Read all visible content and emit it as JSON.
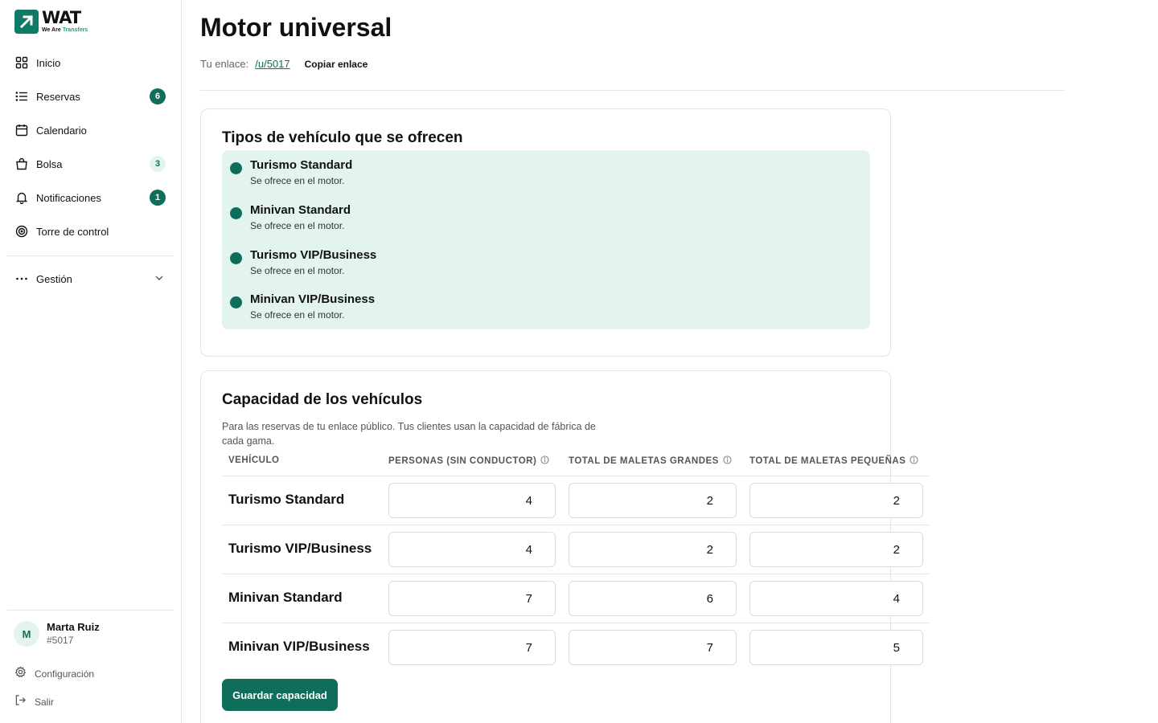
{
  "brand": {
    "logo_word": "WAT",
    "tagline_a": "We Are ",
    "tagline_b": "Transfers",
    "accent": "#0f6e5b",
    "accent_light": "#e3f4ee"
  },
  "sidebar": {
    "items": [
      {
        "label": "Inicio",
        "icon": "grid-icon"
      },
      {
        "label": "Reservas",
        "icon": "list-icon",
        "badge": "6"
      },
      {
        "label": "Calendario",
        "icon": "calendar-icon"
      },
      {
        "label": "Bolsa",
        "icon": "bag-icon",
        "badge": "3"
      },
      {
        "label": "Notificaciones",
        "icon": "bell-icon",
        "badge": "1"
      },
      {
        "label": "Torre de control",
        "icon": "target-icon"
      }
    ],
    "management": {
      "label": "Gestión",
      "icon": "dots-icon"
    },
    "user": {
      "initial": "M",
      "name": "Marta Ruiz",
      "id": "#5017"
    },
    "settings_label": "Configuración",
    "logout_label": "Salir"
  },
  "header": {
    "title": "Motor universal",
    "link_prefix": "Tu enlace:",
    "link_url": "/u/5017",
    "copy_label": "Copiar enlace"
  },
  "vehicle_types": {
    "title": "Tipos de vehículo que se ofrecen",
    "items": [
      {
        "name": "Turismo Standard",
        "status": "Se ofrece en el motor."
      },
      {
        "name": "Minivan Standard",
        "status": "Se ofrece en el motor."
      },
      {
        "name": "Turismo VIP/Business",
        "status": "Se ofrece en el motor."
      },
      {
        "name": "Minivan VIP/Business",
        "status": "Se ofrece en el motor."
      }
    ]
  },
  "capacity": {
    "title": "Capacidad de los vehículos",
    "description": "Para las reservas de tu enlace público. Tus clientes usan la capacidad de fábrica de cada gama.",
    "columns": [
      "VEHÍCULO",
      "PERSONAS (SIN CONDUCTOR)",
      "TOTAL DE MALETAS GRANDES",
      "TOTAL DE MALETAS PEQUEÑAS"
    ],
    "rows": [
      {
        "vehicle": "Turismo Standard",
        "people": "4",
        "large": "2",
        "small": "2"
      },
      {
        "vehicle": "Turismo VIP/Business",
        "people": "4",
        "large": "2",
        "small": "2"
      },
      {
        "vehicle": "Minivan Standard",
        "people": "7",
        "large": "6",
        "small": "4"
      },
      {
        "vehicle": "Minivan VIP/Business",
        "people": "7",
        "large": "7",
        "small": "5"
      }
    ],
    "save_label": "Guardar capacidad"
  }
}
